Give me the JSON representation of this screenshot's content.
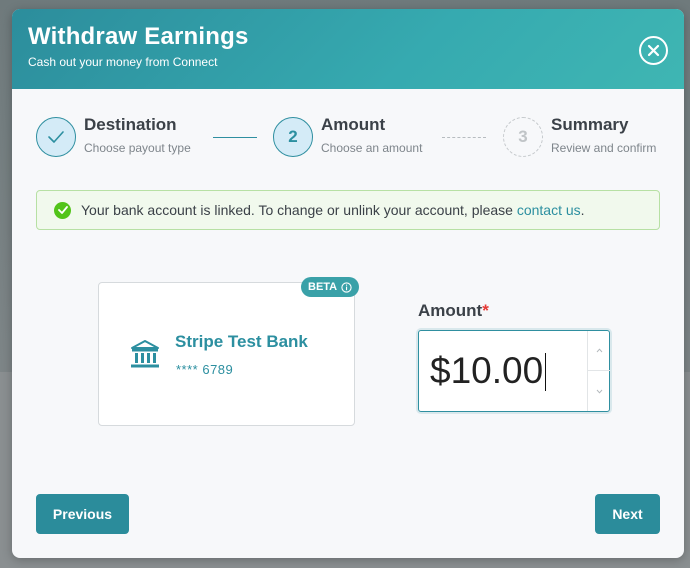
{
  "modal": {
    "title": "Withdraw Earnings",
    "subtitle": "Cash out your money from Connect"
  },
  "steps": [
    {
      "number": "1",
      "title": "Destination",
      "subtitle": "Choose payout type",
      "state": "done"
    },
    {
      "number": "2",
      "title": "Amount",
      "subtitle": "Choose an amount",
      "state": "active"
    },
    {
      "number": "3",
      "title": "Summary",
      "subtitle": "Review and confirm",
      "state": "todo"
    }
  ],
  "alert": {
    "text": "Your bank account is linked. To change or unlink your account, please ",
    "link": "contact us",
    "suffix": "."
  },
  "bank": {
    "badge": "BETA",
    "name": "Stripe Test Bank",
    "masked_number": "**** 6789"
  },
  "amount": {
    "label": "Amount",
    "required_mark": "*",
    "value": "$10.00"
  },
  "buttons": {
    "previous": "Previous",
    "next": "Next"
  },
  "colors": {
    "primary": "#2b8c9b",
    "header_gradient_start": "#2c8d9c",
    "header_gradient_end": "#3fb6b3",
    "success": "#52c41a",
    "required": "#e53935"
  },
  "icons": {
    "close": "close-icon",
    "step_done": "check-icon",
    "alert": "check-circle-icon",
    "bank": "bank-icon",
    "badge_info": "info-icon",
    "spin_up": "chevron-up-icon",
    "spin_down": "chevron-down-icon"
  }
}
